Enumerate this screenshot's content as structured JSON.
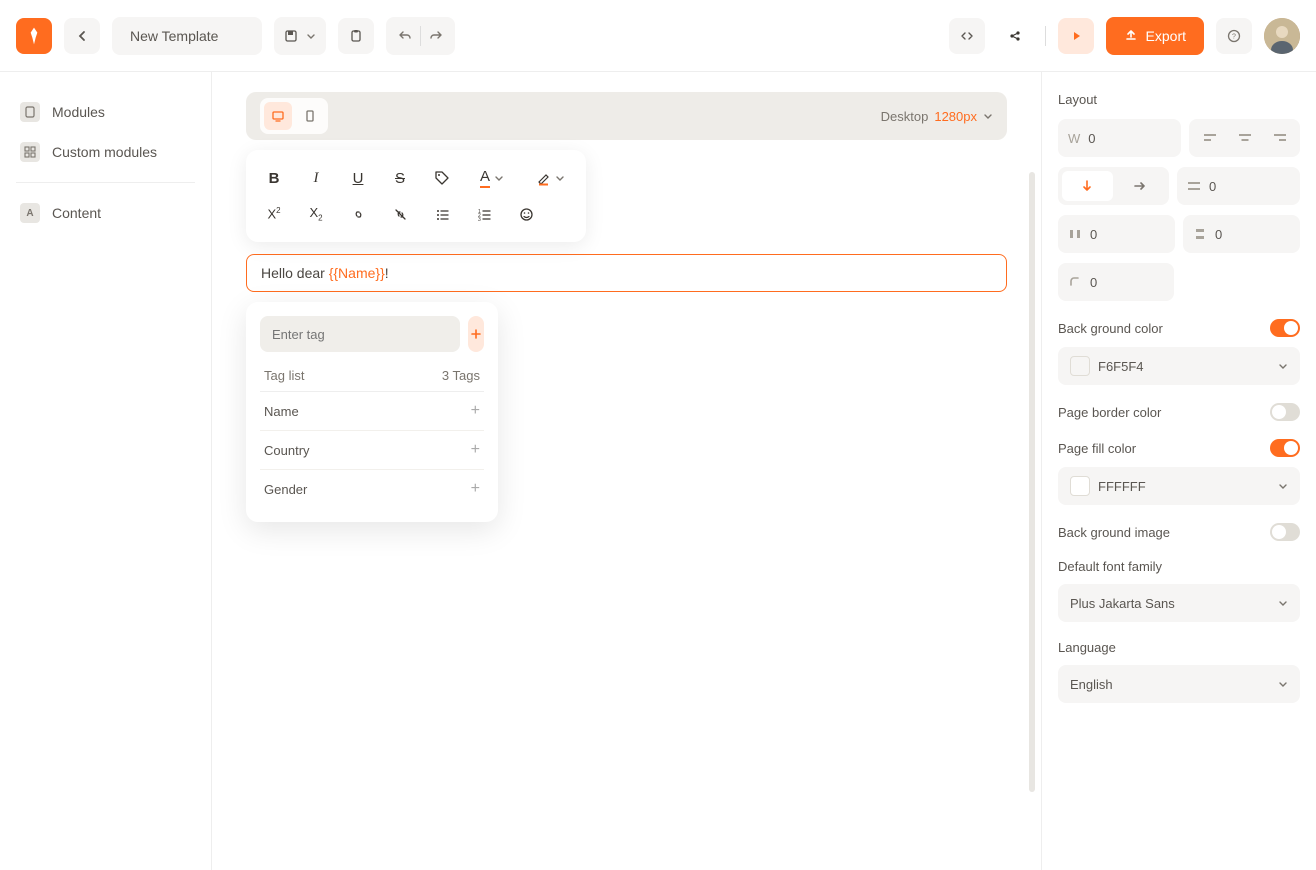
{
  "header": {
    "title": "New Template",
    "export_label": "Export"
  },
  "sidebar": {
    "items": [
      {
        "label": "Modules"
      },
      {
        "label": "Custom modules"
      },
      {
        "label": "Content"
      }
    ]
  },
  "canvas": {
    "device_label": "Desktop",
    "device_size": "1280px",
    "text_before": "Hello dear ",
    "text_tag": "{{Name}}",
    "text_after": "!",
    "tag_popup": {
      "input_placeholder": "Enter tag",
      "list_title": "Tag list",
      "count_label": "3 Tags",
      "tags": [
        {
          "label": "Name"
        },
        {
          "label": "Country"
        },
        {
          "label": "Gender"
        }
      ]
    }
  },
  "right_panel": {
    "layout_title": "Layout",
    "w_label": "W",
    "w_value": "0",
    "flex_value": "0",
    "pad_left": "0",
    "pad_right": "0",
    "radius": "0",
    "bg_color_label": "Back ground color",
    "bg_color_value": "F6F5F4",
    "border_color_label": "Page border color",
    "fill_color_label": "Page fill color",
    "fill_color_value": "FFFFFF",
    "bg_image_label": "Back ground image",
    "font_label": "Default font family",
    "font_value": "Plus Jakarta Sans",
    "lang_label": "Language",
    "lang_value": "English"
  },
  "colors": {
    "accent": "#ff6c1f"
  }
}
